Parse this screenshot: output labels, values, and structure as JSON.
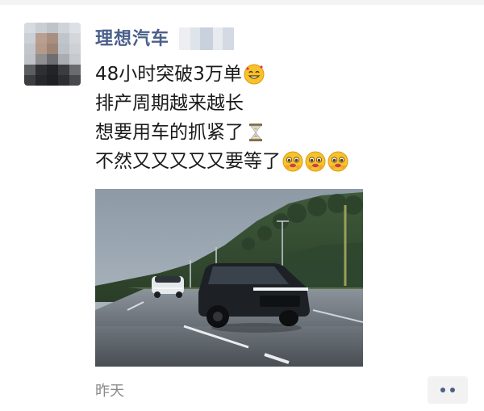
{
  "post": {
    "author": "理想汽车",
    "lines": [
      "48小时突破3万单",
      "排产周期越来越长",
      "想要用车的抓紧了",
      "不然又又又又又要等了"
    ],
    "line_emojis": [
      [
        "smiling-face-with-hearts-icon"
      ],
      [],
      [
        "hourglass-icon"
      ],
      [
        "face-holding-back-tears-icon",
        "face-holding-back-tears-icon",
        "face-holding-back-tears-icon"
      ]
    ],
    "timestamp": "昨天"
  },
  "photo": {
    "description_icon": "car-photo"
  },
  "colors": {
    "author_link": "#4a5f8a",
    "body_text": "#1a1a1a",
    "timestamp": "#8a8a8a",
    "more_button_bg": "#f2f2f2"
  }
}
